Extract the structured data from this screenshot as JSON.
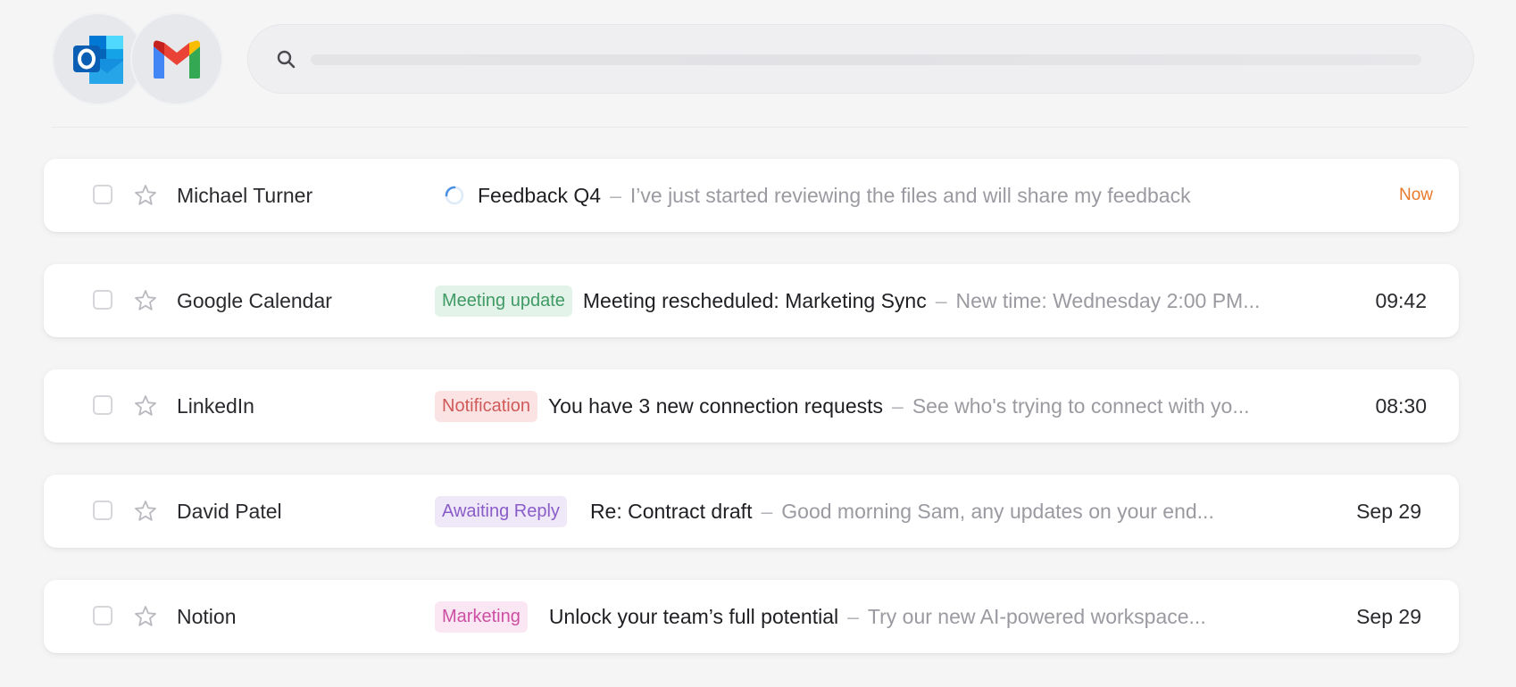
{
  "apps": [
    {
      "name": "Outlook",
      "icon": "outlook-icon"
    },
    {
      "name": "Gmail",
      "icon": "gmail-icon"
    }
  ],
  "search": {
    "value": "",
    "placeholder": "",
    "icon": "search-icon"
  },
  "colors": {
    "accent_now": "#e8792b",
    "tag_meeting_bg": "#e3f3e9",
    "tag_meeting_fg": "#3f9a64",
    "tag_notification_bg": "#fbe3e3",
    "tag_notification_fg": "#d05a5a",
    "tag_awaiting_bg": "#efe8f8",
    "tag_awaiting_fg": "#8a5cc8",
    "tag_marketing_bg": "#fbe6f3",
    "tag_marketing_fg": "#cc4fa3"
  },
  "emails": [
    {
      "sender": "Michael Turner",
      "status_icon": "loading-spinner-icon",
      "subject": "Feedback Q4",
      "dash": "–",
      "preview": "I’ve just started reviewing the files and will share my feedback",
      "time": "Now"
    },
    {
      "sender": "Google Calendar",
      "tag": "Meeting update",
      "subject": "Meeting rescheduled: Marketing Sync",
      "dash": "–",
      "preview": "New time: Wednesday 2:00 PM...",
      "time": "09:42"
    },
    {
      "sender": "LinkedIn",
      "tag": "Notification",
      "subject": "You have 3 new connection requests",
      "dash": "–",
      "preview": "See who's trying to connect with yo...",
      "time": "08:30"
    },
    {
      "sender": "David Patel",
      "tag": "Awaiting Reply",
      "subject": "Re: Contract draft",
      "dash": "–",
      "preview": "Good morning Sam, any updates on your end...",
      "time": "Sep 29"
    },
    {
      "sender": "Notion",
      "tag": "Marketing",
      "subject": "Unlock your team’s full potential",
      "dash": "–",
      "preview": "Try our new AI-powered workspace...",
      "time": "Sep 29"
    }
  ]
}
